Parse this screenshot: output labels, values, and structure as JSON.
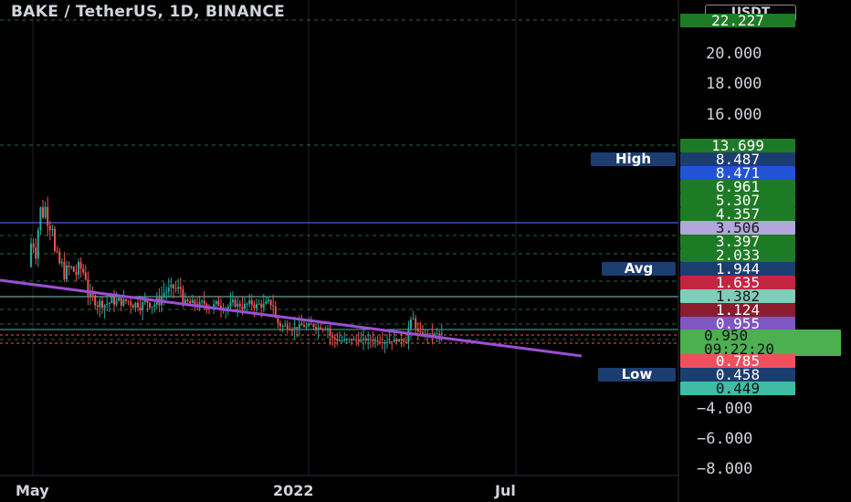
{
  "header": {
    "symbol": "BAKE / TetherUS, 1D, BINANCE",
    "currency": "USDT"
  },
  "price_axis": {
    "tick_labels": [
      "20.000",
      "18.000",
      "16.000",
      "−4.000",
      "−6.000",
      "−8.000"
    ]
  },
  "price_tags": [
    {
      "value": "22.227",
      "color": "#1e7b25"
    },
    {
      "value": "13.699",
      "color": "#1e7b25"
    },
    {
      "value": "8.487",
      "color": "#1c3d6f"
    },
    {
      "value": "8.471",
      "color": "#2253d6"
    },
    {
      "value": "6.961",
      "color": "#1e7b25"
    },
    {
      "value": "5.307",
      "color": "#1e7b25"
    },
    {
      "value": "4.357",
      "color": "#1e7b25"
    },
    {
      "value": "3.506",
      "color": "#b2a7dc"
    },
    {
      "value": "3.397",
      "color": "#1e7b25"
    },
    {
      "value": "2.033",
      "color": "#1e7b25"
    },
    {
      "value": "1.944",
      "color": "#1c3d6f"
    },
    {
      "value": "1.635",
      "color": "#c2263f"
    },
    {
      "value": "1.382",
      "color": "#7fcdbb"
    },
    {
      "value": "1.124",
      "color": "#8c1b2c"
    },
    {
      "value": "0.955",
      "color": "#7e57c2"
    },
    {
      "value": "0.950",
      "color": "#4caf50"
    },
    {
      "value": "09:22:20",
      "color": "#4caf50"
    },
    {
      "value": "0.785",
      "color": "#f0505e"
    },
    {
      "value": "0.458",
      "color": "#1c3d6f"
    },
    {
      "value": "0.449",
      "color": "#3fbca3"
    }
  ],
  "name_tags": {
    "high": "High",
    "avg": "Avg",
    "low": "Low"
  },
  "time_axis": {
    "labels": [
      "May",
      "2022",
      "Jul"
    ]
  },
  "colors": {
    "up": "#26a69a",
    "down": "#ef5350",
    "trendline": "#9c4fd6",
    "hline": "#3f51b5",
    "background": "#000000"
  },
  "chart_data": {
    "type": "candlestick",
    "title": "BAKE / TetherUS, 1D, BINANCE",
    "ylabel": "USDT",
    "x_labels": [
      "May",
      "2022",
      "Jul"
    ],
    "price_levels": {
      "high": 8.487,
      "avg": 1.944,
      "low": 0.458,
      "last": 0.95,
      "countdown": "09:22:20",
      "horizontal_line": 3.506
    },
    "trendline": {
      "from_price": 6.0,
      "to_price": -0.2
    },
    "y_axis_ticks": [
      20,
      18,
      16,
      -4,
      -6,
      -8
    ],
    "grid": true
  }
}
